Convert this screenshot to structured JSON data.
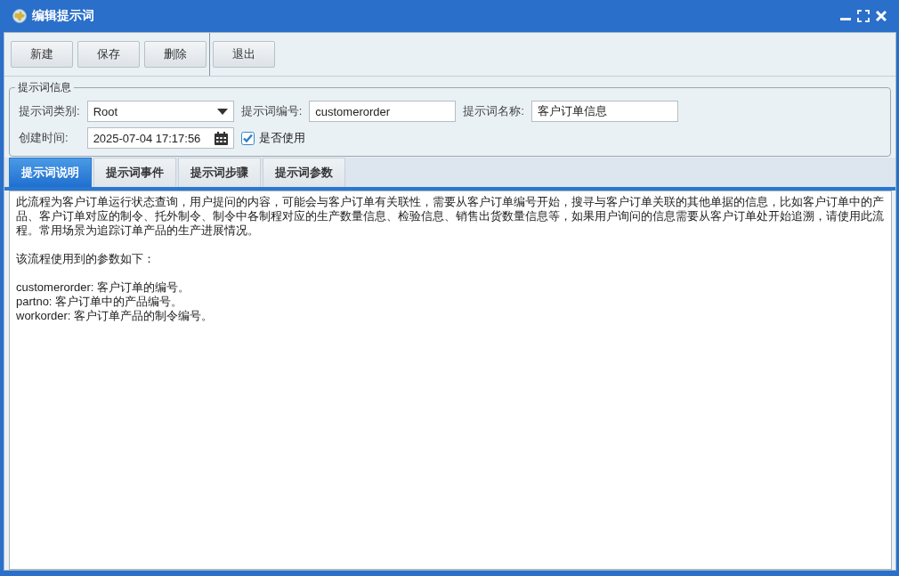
{
  "window": {
    "title": "编辑提示词"
  },
  "toolbar": {
    "groups": [
      [
        "新建",
        "保存",
        "删除"
      ],
      [
        "退出"
      ]
    ]
  },
  "info": {
    "legend": "提示词信息",
    "fields": [
      {
        "kind": "select",
        "label": "提示词类别:",
        "value": "Root"
      },
      {
        "kind": "text",
        "label": "提示词编号:",
        "value": "customerorder"
      },
      {
        "kind": "text",
        "label": "提示词名称:",
        "value": "客户订单信息"
      },
      {
        "kind": "date",
        "label": "创建时间:",
        "value": "2025-07-04 17:17:56"
      },
      {
        "kind": "checkbox",
        "label": "是否使用",
        "checked": true
      }
    ]
  },
  "tabs": [
    {
      "label": "提示词说明",
      "selected": true
    },
    {
      "label": "提示词事件",
      "selected": false
    },
    {
      "label": "提示词步骤",
      "selected": false
    },
    {
      "label": "提示词参数",
      "selected": false
    }
  ],
  "description": {
    "paragraphs": [
      [
        "此流程为客户订单运行状态查询，用户提问的内容，可能会与客户订单有关联性，需要从客户订单编号开始，搜寻与客户订单关联的其他单据的信息，比如客户订单中的产品、客户订单对应的制令、托外制令、制令中各制程对应的生产数量信息、检验信息、销售出货数量信息等，如果用户询问的信息需要从客户订单处开始追溯，请使用此流程。常用场景为追踪订单产品的生产进展情况。"
      ],
      [
        "该流程使用到的参数如下："
      ],
      [
        "customerorder: 客户订单的编号。",
        "partno: 客户订单中的产品编号。",
        "workorder: 客户订单产品的制令编号。"
      ]
    ]
  }
}
